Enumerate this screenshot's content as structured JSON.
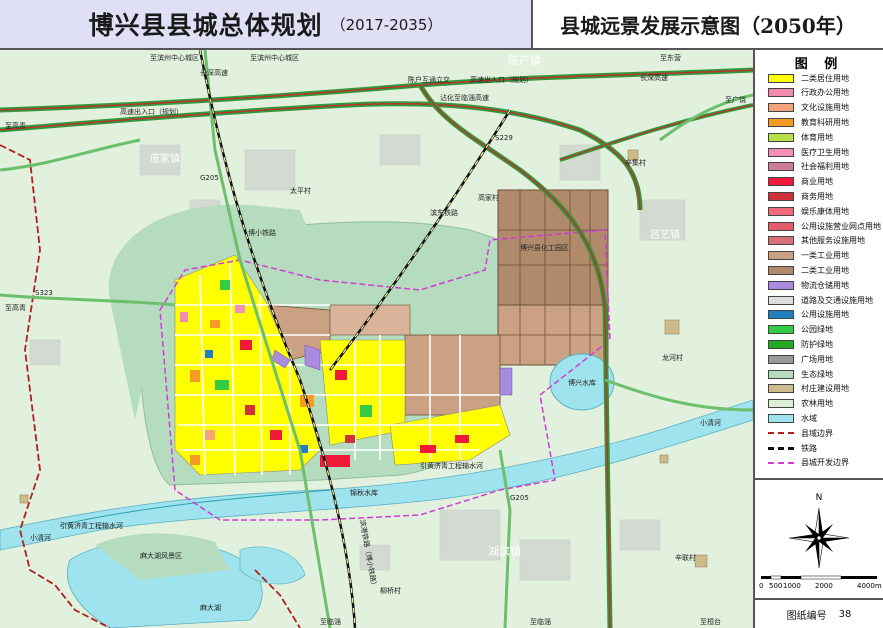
{
  "title": {
    "main": "博兴县县城总体规划",
    "years": "（2017-2035）",
    "subtitle": "县城远景发展示意图（2050年）"
  },
  "legend": {
    "heading": "图  例",
    "items": [
      {
        "label": "二类居住用地",
        "color": "#ffff00",
        "kind": "fill"
      },
      {
        "label": "行政办公用地",
        "color": "#f28bb0",
        "kind": "fill"
      },
      {
        "label": "文化设施用地",
        "color": "#f4a27a",
        "kind": "fill"
      },
      {
        "label": "教育科研用地",
        "color": "#f59a23",
        "kind": "fill"
      },
      {
        "label": "体育用地",
        "color": "#b7e04a",
        "kind": "fill"
      },
      {
        "label": "医疗卫生用地",
        "color": "#f28fb8",
        "kind": "fill"
      },
      {
        "label": "社会福利用地",
        "color": "#cf7b9a",
        "kind": "fill"
      },
      {
        "label": "商业用地",
        "color": "#f0193a",
        "kind": "fill"
      },
      {
        "label": "商务用地",
        "color": "#d0323a",
        "kind": "fill"
      },
      {
        "label": "娱乐康体用地",
        "color": "#f06b7a",
        "kind": "fill"
      },
      {
        "label": "公用设施营业网点用地",
        "color": "#e35c6a",
        "kind": "fill"
      },
      {
        "label": "其他服务设施用地",
        "color": "#d8707c",
        "kind": "fill"
      },
      {
        "label": "一类工业用地",
        "color": "#cba184",
        "kind": "fill"
      },
      {
        "label": "二类工业用地",
        "color": "#b08a6a",
        "kind": "fill"
      },
      {
        "label": "物流仓储用地",
        "color": "#a98be0",
        "kind": "fill"
      },
      {
        "label": "道路及交通设施用地",
        "color": "#dddddd",
        "kind": "fill"
      },
      {
        "label": "公用设施用地",
        "color": "#1f7fbf",
        "kind": "fill"
      },
      {
        "label": "公园绿地",
        "color": "#33cc44",
        "kind": "fill"
      },
      {
        "label": "防护绿地",
        "color": "#22aa22",
        "kind": "fill"
      },
      {
        "label": "广场用地",
        "color": "#9a9a9a",
        "kind": "fill"
      },
      {
        "label": "生态绿地",
        "color": "#b6dcc0",
        "kind": "fill"
      },
      {
        "label": "村庄建设用地",
        "color": "#cdbb8a",
        "kind": "fill"
      },
      {
        "label": "农林用地",
        "color": "#ddefd8",
        "kind": "fill"
      },
      {
        "label": "水域",
        "color": "#9fe3ee",
        "kind": "fill"
      },
      {
        "label": "县域边界",
        "color": "#b02020",
        "kind": "dash"
      },
      {
        "label": "铁路",
        "color": "#111111",
        "kind": "rail"
      },
      {
        "label": "县城开发边界",
        "color": "#d23ad8",
        "kind": "dash"
      }
    ]
  },
  "compass": {
    "north": "N"
  },
  "scale": {
    "ticks": [
      "0",
      "500",
      "1000",
      "2000",
      "4000m"
    ]
  },
  "sheet": {
    "label": "图纸编号",
    "number": "38"
  },
  "map_labels": {
    "to_binzhou_center": "至滨州中心城区",
    "to_binzhou_center2": "至滨州中心城区",
    "to_dongying": "至东营",
    "changshen_hw": "长深高速",
    "changshen_hw2": "长深高速",
    "chenhu_town": "陈户镇",
    "chenhu_interchange": "陈户互通立交",
    "hw_exit_plan": "高速出入口（规划）",
    "hw_exit_plan2": "高速出入口（规划）",
    "to_gaoqing": "至高青",
    "to_gaoqing2": "至高青",
    "to_guangrao": "至广饶",
    "yanhua_hw": "沾化至临淄高速",
    "s229": "S229",
    "lvjia_town": "庞家镇",
    "g205": "G205",
    "taiping": "太平村",
    "lucang_rail": "博小铁路",
    "huxi_rail": "滨东铁路",
    "gaojia": "高家村",
    "chem_park": "博兴县化工园区",
    "lvyi_town": "吕艺镇",
    "xinji": "辛集村",
    "s323": "S323",
    "boxing_reservoir": "博兴水库",
    "longhe": "龙河村",
    "xiaoqinghe": "小清河",
    "xiaoqinghe2": "小清河",
    "lianghu": "锦秋水库",
    "g205b": "G205",
    "hubin_town": "湖滨镇",
    "madahu": "麻大湖",
    "madahu_wetland": "麻大湖风景区",
    "liuqiao": "柳桥村",
    "xingfu": "辛联村",
    "to_linzi": "至临淄",
    "to_linzi2": "至临淄",
    "to_huantai": "至桓台",
    "zhanhua_rail": "滨港铁路（博小铁路）",
    "yinghuang": "引黄济青工程输水河",
    "yinghuang2": "引黄济青工程输水河"
  }
}
